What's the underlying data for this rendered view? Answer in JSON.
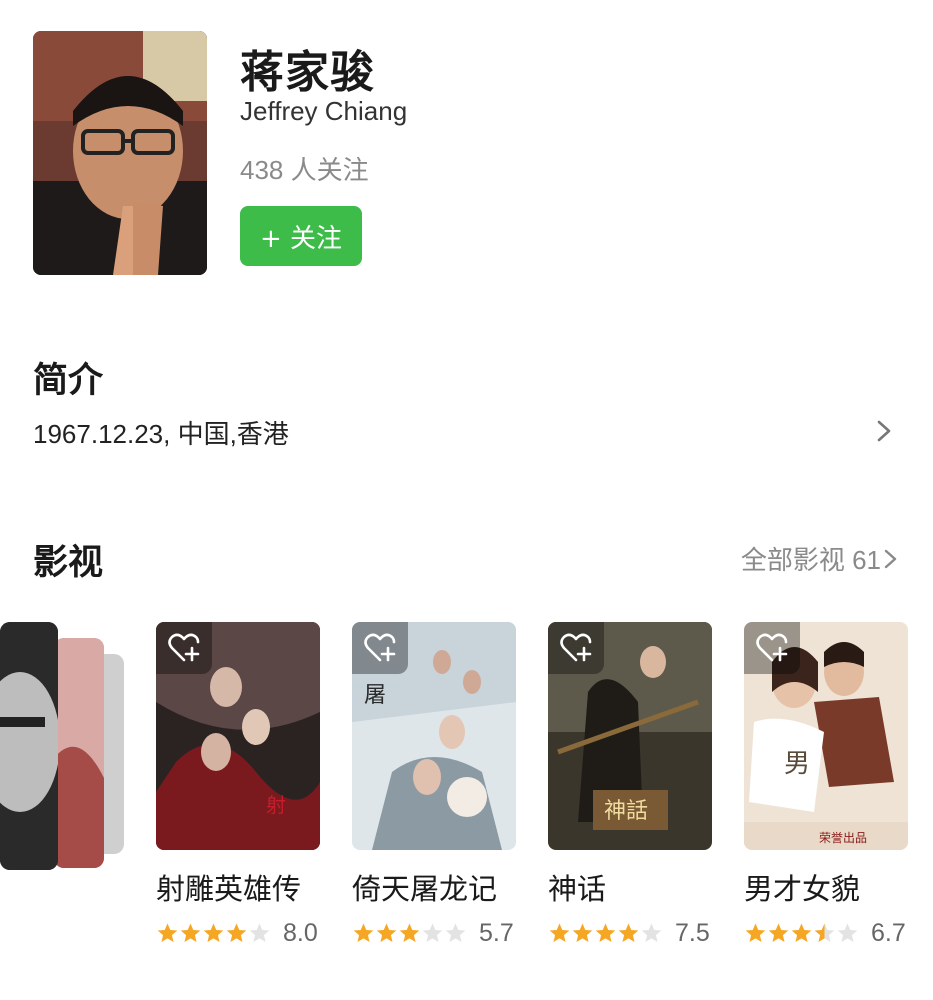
{
  "person": {
    "name_cn": "蒋家骏",
    "name_en": "Jeffrey Chiang",
    "followers": "438 人关注",
    "follow_label": "+ 关注",
    "avatar_icon": "portrait-photo"
  },
  "intro": {
    "title": "简介",
    "text": "1967.12.23, 中国,香港"
  },
  "films": {
    "title": "影视",
    "all_label": "全部影视 61",
    "items": [
      {
        "title": "射雕英雄传",
        "score": "8.0",
        "stars": 4
      },
      {
        "title": "倚天屠龙记",
        "score": "5.7",
        "stars": 3
      },
      {
        "title": "神话",
        "score": "7.5",
        "stars": 4
      },
      {
        "title": "男才女貌",
        "score": "6.7",
        "stars": 3.5
      }
    ]
  },
  "colors": {
    "accent": "#3ebc4a",
    "star_on": "#f5a623",
    "star_off": "#e3e3e3",
    "muted": "#8a8a8a"
  },
  "icons": {
    "heart": "heart-plus-icon",
    "chevron": "chevron-right-icon",
    "star": "star-icon"
  }
}
